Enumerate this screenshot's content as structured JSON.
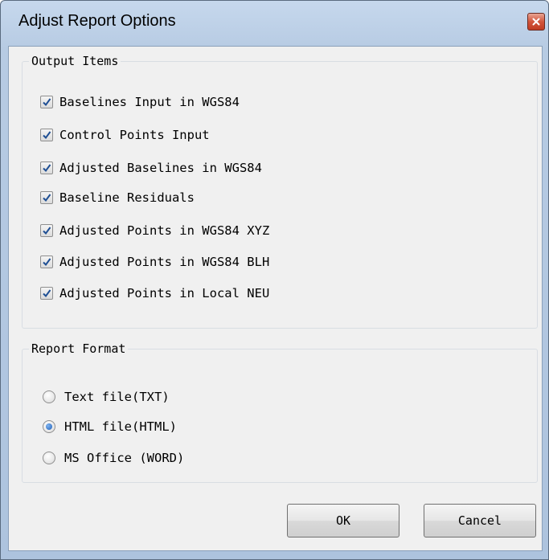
{
  "window": {
    "title": "Adjust Report Options"
  },
  "output_items": {
    "legend": "Output Items",
    "items": [
      {
        "label": "Baselines Input in WGS84",
        "checked": true
      },
      {
        "label": "Control Points Input",
        "checked": true
      },
      {
        "label": "Adjusted Baselines in WGS84",
        "checked": true
      },
      {
        "label": "Baseline Residuals",
        "checked": true
      },
      {
        "label": "Adjusted Points in WGS84 XYZ",
        "checked": true
      },
      {
        "label": "Adjusted Points in WGS84 BLH",
        "checked": true
      },
      {
        "label": "Adjusted Points in Local NEU",
        "checked": true
      }
    ]
  },
  "report_format": {
    "legend": "Report Format",
    "options": [
      {
        "label": "Text file(TXT)",
        "selected": false
      },
      {
        "label": "HTML file(HTML)",
        "selected": true
      },
      {
        "label": "MS Office (WORD)",
        "selected": false
      }
    ]
  },
  "buttons": {
    "ok": "OK",
    "cancel": "Cancel"
  },
  "colors": {
    "check_mark": "#1f4f94",
    "radio_selected": "#1f5fb8"
  }
}
